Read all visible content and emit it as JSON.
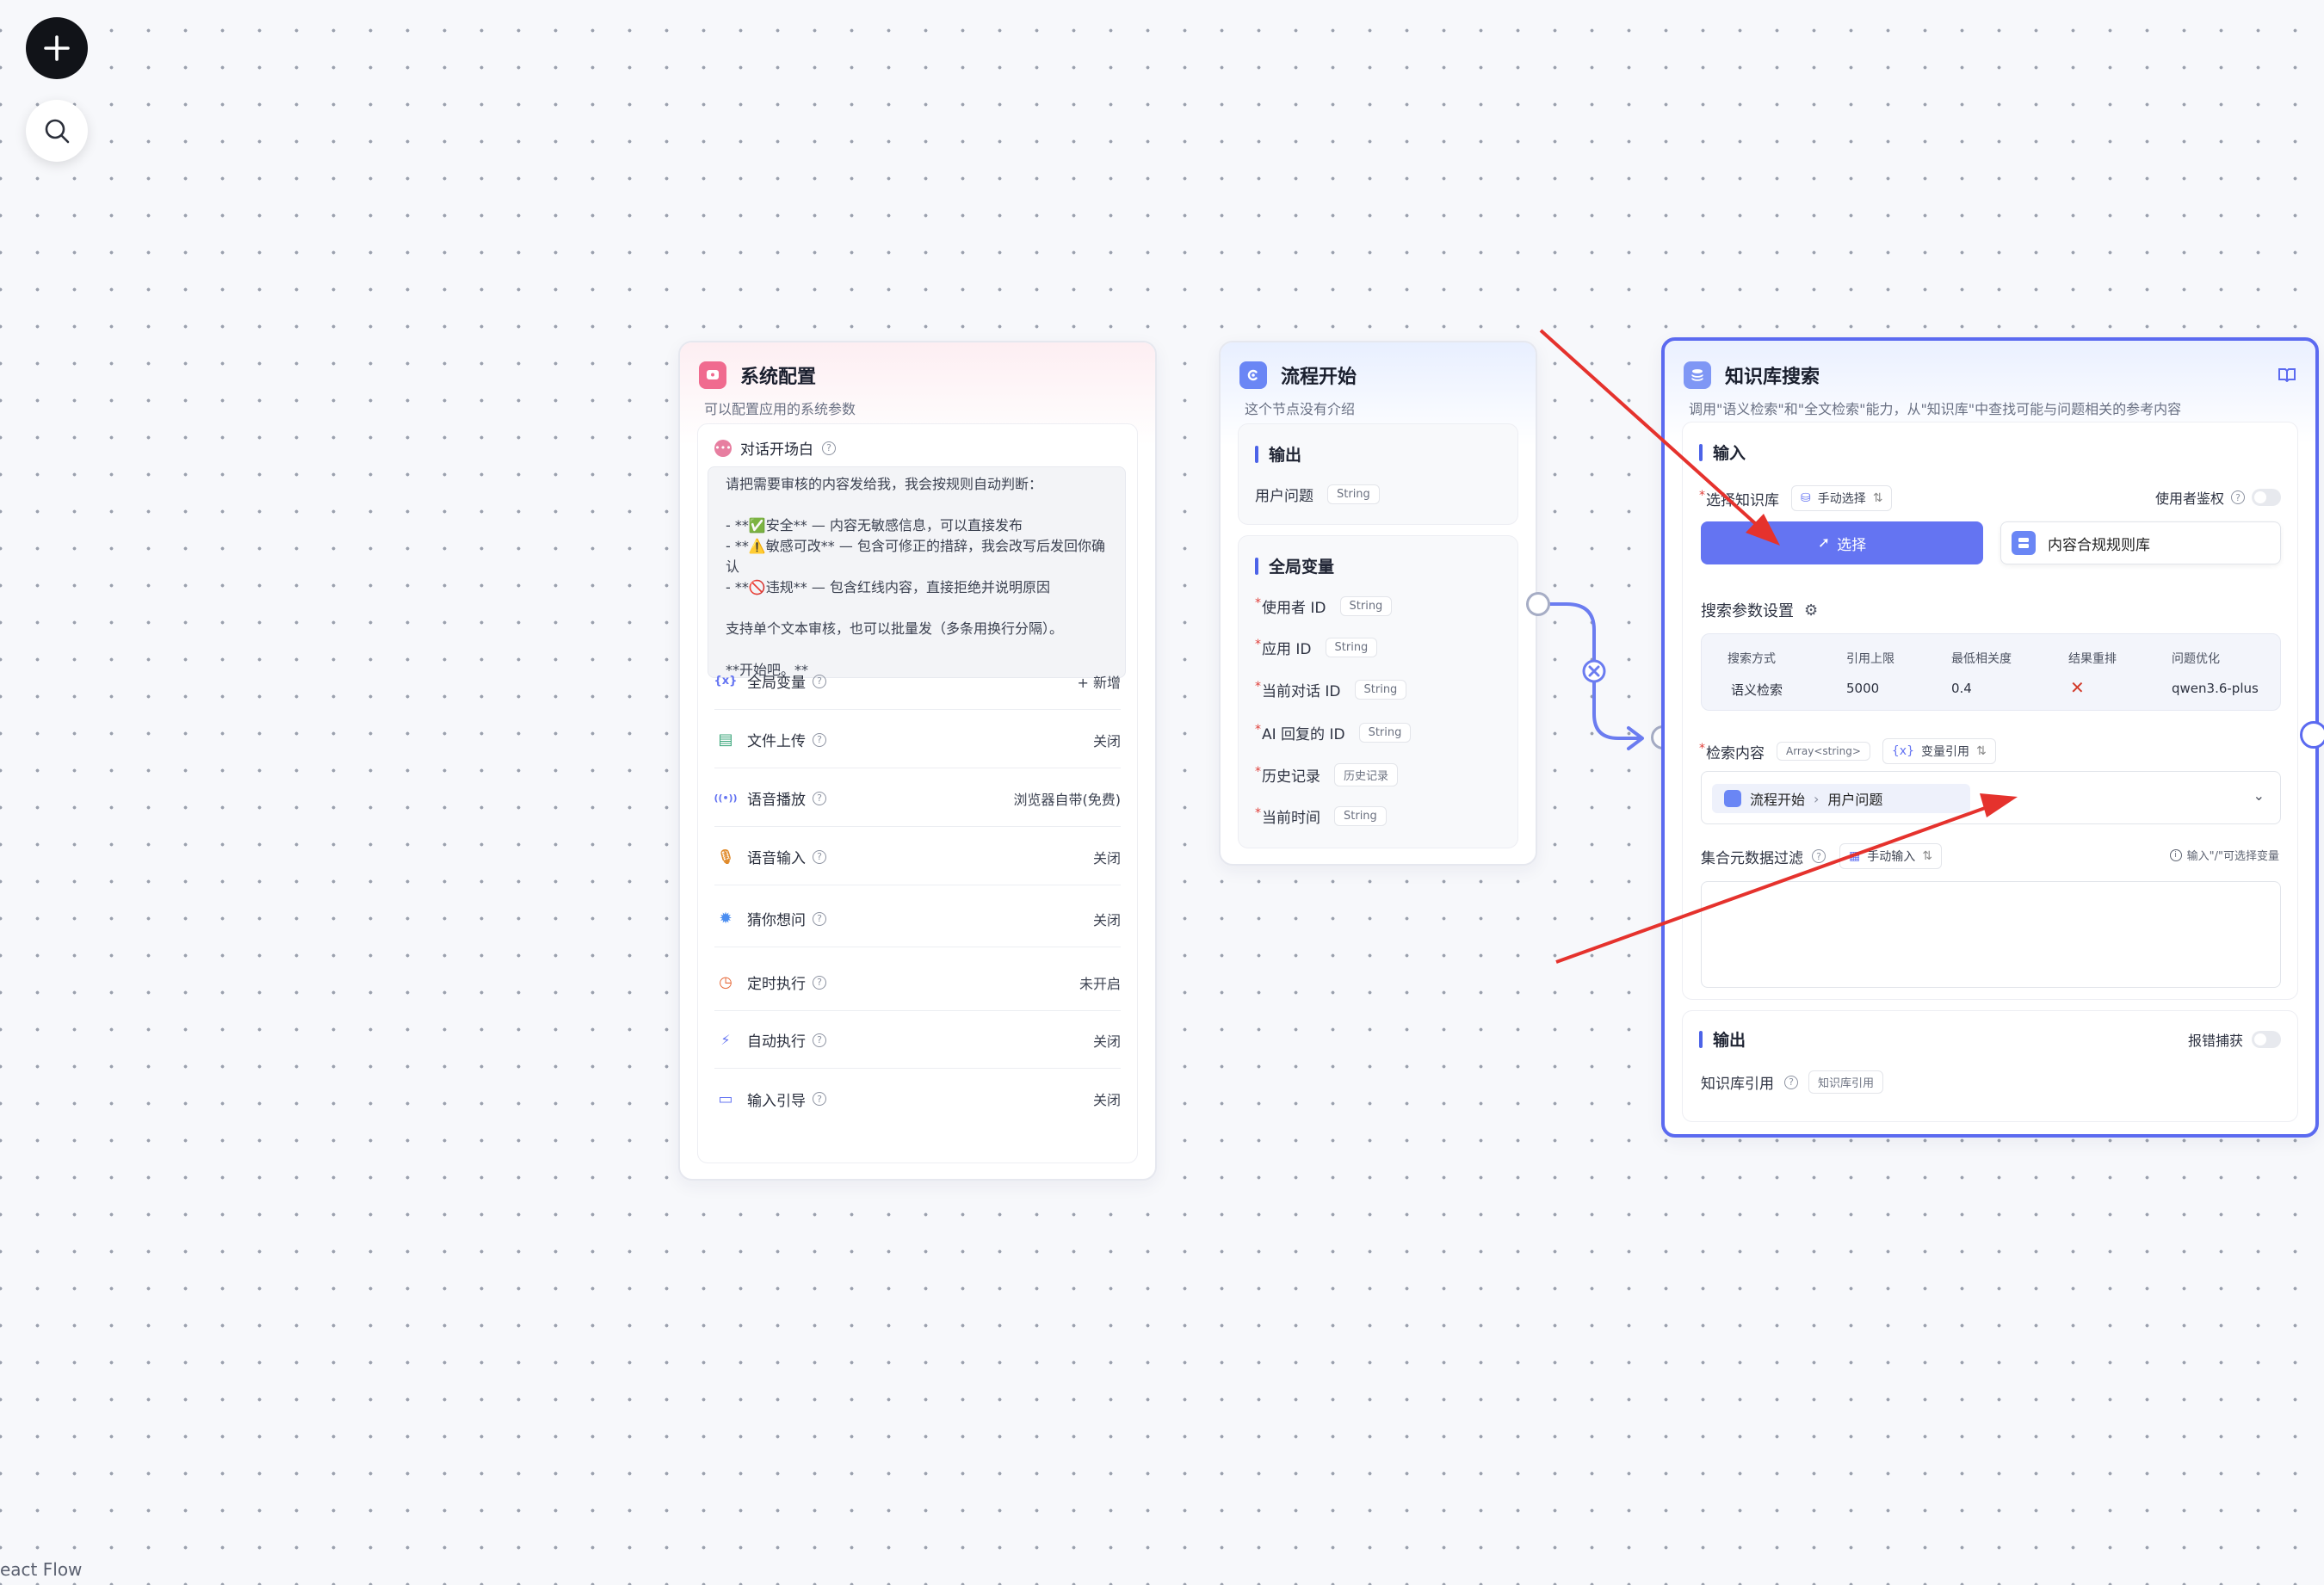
{
  "toolbar": {
    "add_icon": "plus-icon",
    "search_icon": "search-icon"
  },
  "system_config": {
    "title": "系统配置",
    "desc": "可以配置应用的系统参数",
    "opening": {
      "label": "对话开场白",
      "text": "请把需要审核的内容发给我，我会按规则自动判断：\n\n- **✅安全** — 内容无敏感信息，可以直接发布\n- **⚠️敏感可改** — 包含可修正的措辞，我会改写后发回你确认\n- **🚫违规** — 包含红线内容，直接拒绝并说明原因\n\n支持单个文本审核，也可以批量发（多条用换行分隔）。\n\n**开始吧。**"
    },
    "rows": [
      {
        "label": "全局变量",
        "value": "+ 新增",
        "icon": "variable-icon"
      },
      {
        "label": "文件上传",
        "value": "关闭",
        "icon": "file-upload-icon"
      },
      {
        "label": "语音播放",
        "value": "浏览器自带(免费)",
        "icon": "speaker-icon"
      },
      {
        "label": "语音输入",
        "value": "关闭",
        "icon": "microphone-icon"
      },
      {
        "label": "猜你想问",
        "value": "关闭",
        "icon": "lightbulb-icon"
      },
      {
        "label": "定时执行",
        "value": "未开启",
        "icon": "timer-icon"
      },
      {
        "label": "自动执行",
        "value": "关闭",
        "icon": "lightning-icon"
      },
      {
        "label": "输入引导",
        "value": "关闭",
        "icon": "keyboard-icon"
      }
    ]
  },
  "flow_start": {
    "title": "流程开始",
    "desc": "这个节点没有介绍",
    "output_title": "输出",
    "output_field": {
      "label": "用户问题",
      "type": "String"
    },
    "globals_title": "全局变量",
    "globals": [
      {
        "label": "使用者 ID",
        "type": "String"
      },
      {
        "label": "应用 ID",
        "type": "String"
      },
      {
        "label": "当前对话 ID",
        "type": "String"
      },
      {
        "label": "AI 回复的 ID",
        "type": "String"
      },
      {
        "label": "历史记录",
        "type": "历史记录"
      },
      {
        "label": "当前时间",
        "type": "String"
      }
    ]
  },
  "kb_search": {
    "title": "知识库搜索",
    "desc": "调用\"语义检索\"和\"全文检索\"能力，从\"知识库\"中查找可能与问题相关的参考内容",
    "input_title": "输入",
    "select_kb_label": "选择知识库",
    "select_mode": "手动选择",
    "auth_label": "使用者鉴权",
    "select_button": "选择",
    "selected_kb": "内容合规规则库",
    "params_title": "搜索参数设置",
    "params_headers": [
      "搜索方式",
      "引用上限",
      "最低相关度",
      "结果重排",
      "问题优化"
    ],
    "params_values": [
      "语义检索",
      "5000",
      "0.4",
      "✕",
      "qwen3.6-plus"
    ],
    "query_label": "检索内容",
    "query_type": "Array<string>",
    "query_mode": "变量引用",
    "query_ref_node": "流程开始",
    "query_ref_field": "用户问题",
    "filter_label": "集合元数据过滤",
    "filter_mode": "手动输入",
    "filter_hint": "输入\"/\"可选择变量",
    "output_title": "输出",
    "error_catch_label": "报错捕获",
    "output_field": {
      "label": "知识库引用",
      "type": "知识库引用"
    }
  },
  "colors": {
    "accent": "#5b6af0",
    "annotation": "#e5322d"
  },
  "footer": "eact Flow"
}
